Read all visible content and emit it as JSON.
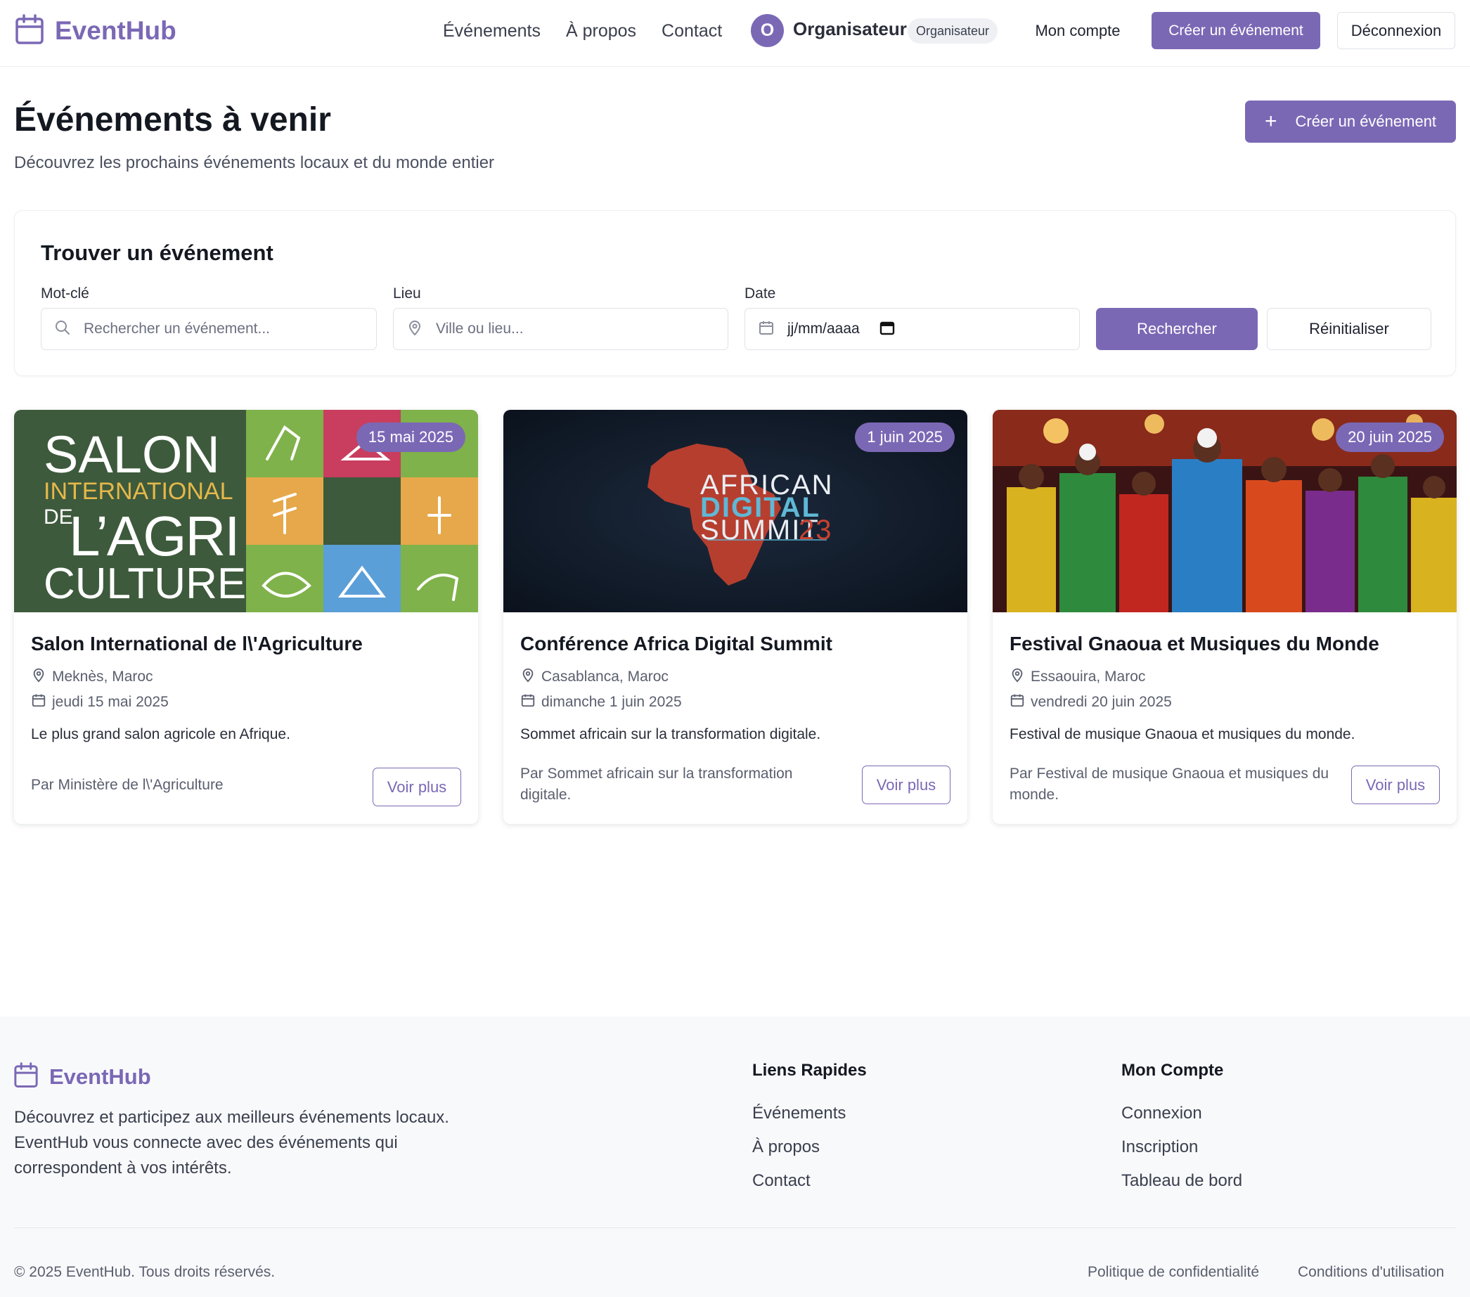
{
  "header": {
    "brand": "EventHub",
    "nav": [
      "Événements",
      "À propos",
      "Contact"
    ],
    "user": {
      "initial": "O",
      "name": "Organisateur",
      "role": "Organisateur"
    },
    "account_label": "Mon compte",
    "create_label": "Créer un événement",
    "logout_label": "Déconnexion"
  },
  "hero": {
    "title": "Événements à venir",
    "subtitle": "Découvrez les prochains événements locaux et du monde entier",
    "create_label": "Créer un événement",
    "create_icon": "plus-icon"
  },
  "search": {
    "title": "Trouver un événement",
    "keyword_label": "Mot-clé",
    "keyword_placeholder": "Rechercher un événement...",
    "location_label": "Lieu",
    "location_placeholder": "Ville ou lieu...",
    "date_label": "Date",
    "date_value": "jj/mm/aaaa",
    "search_label": "Rechercher",
    "reset_label": "Réinitialiser"
  },
  "events": [
    {
      "badge": "15 mai 2025",
      "title": "Salon International de l\\'Agriculture",
      "location": "Meknès, Maroc",
      "date": "jeudi 15 mai 2025",
      "description": "Le plus grand salon agricole en Afrique.",
      "organizer": "Par Ministère de l\\'Agriculture",
      "more_label": "Voir plus",
      "image": {
        "line1": "SALON",
        "line2": "INTERNATIONAL",
        "line3a": "DE",
        "line3b": "L’AGRI",
        "line4": "CULTURE"
      }
    },
    {
      "badge": "1 juin 2025",
      "title": "Conférence Africa Digital Summit",
      "location": "Casablanca, Maroc",
      "date": "dimanche 1 juin 2025",
      "description": "Sommet africain sur la transformation digitale.",
      "organizer": "Par Sommet africain sur la transformation digitale.",
      "more_label": "Voir plus",
      "image": {
        "line1": "AFRICAN",
        "line2": "DIGITAL",
        "line3a": "SUMMIT",
        "line3b": "23"
      }
    },
    {
      "badge": "20 juin 2025",
      "title": "Festival Gnaoua et Musiques du Monde",
      "location": "Essaouira, Maroc",
      "date": "vendredi 20 juin 2025",
      "description": "Festival de musique Gnaoua et musiques du monde.",
      "organizer": "Par Festival de musique Gnaoua et musiques du monde.",
      "more_label": "Voir plus"
    }
  ],
  "footer": {
    "brand": "EventHub",
    "about": "Découvrez et participez aux meilleurs événements locaux. EventHub vous connecte avec des événements qui correspondent à vos intérêts.",
    "quick_links_title": "Liens Rapides",
    "quick_links": [
      "Événements",
      "À propos",
      "Contact"
    ],
    "account_title": "Mon Compte",
    "account_links": [
      "Connexion",
      "Inscription",
      "Tableau de bord"
    ],
    "copyright": "© 2025 EventHub. Tous droits réservés.",
    "privacy": "Politique de confidentialité",
    "terms": "Conditions d'utilisation"
  },
  "colors": {
    "accent": "#7b68b5",
    "text": "#1f2330",
    "muted": "#5a5f6e",
    "footer_bg": "#f8f9fb"
  }
}
